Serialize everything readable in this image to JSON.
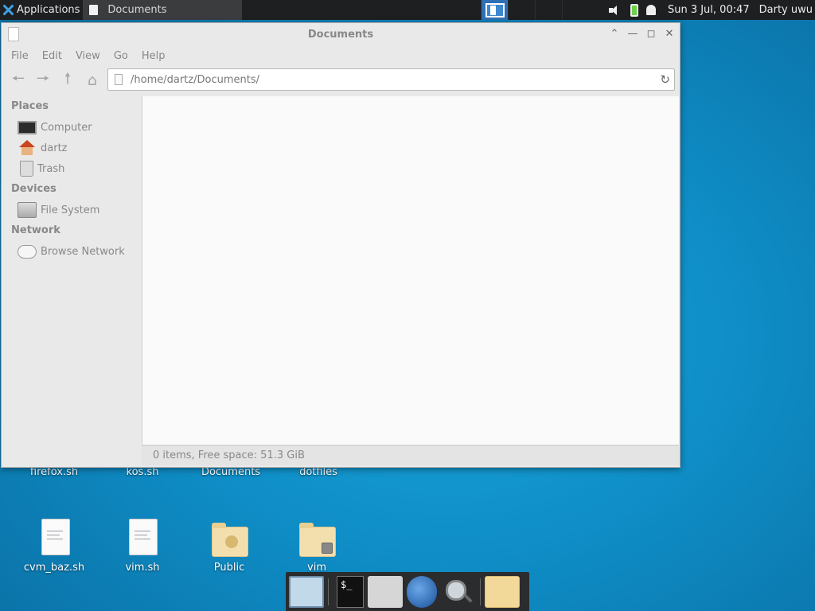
{
  "top_panel": {
    "applications_label": "Applications",
    "task_title": "Documents",
    "clock": "Sun  3 Jul, 00:47",
    "user": "Darty uwu"
  },
  "window": {
    "title": "Documents",
    "menu": [
      "File",
      "Edit",
      "View",
      "Go",
      "Help"
    ],
    "path": "/home/dartz/Documents/",
    "sidebar": {
      "places_heading": "Places",
      "places": [
        "Computer",
        "dartz",
        "Trash"
      ],
      "devices_heading": "Devices",
      "devices": [
        "File System"
      ],
      "network_heading": "Network",
      "network": [
        "Browse Network"
      ]
    },
    "status": "0 items, Free space: 51.3 GiB"
  },
  "desktop": {
    "row1": [
      "firefox.sh",
      "kos.sh",
      "Documents",
      "dotfiles"
    ],
    "row2": [
      "cvm_baz.sh",
      "vim.sh",
      "Public",
      "vim"
    ]
  },
  "dock": {
    "terminal_prompt": "$_"
  }
}
